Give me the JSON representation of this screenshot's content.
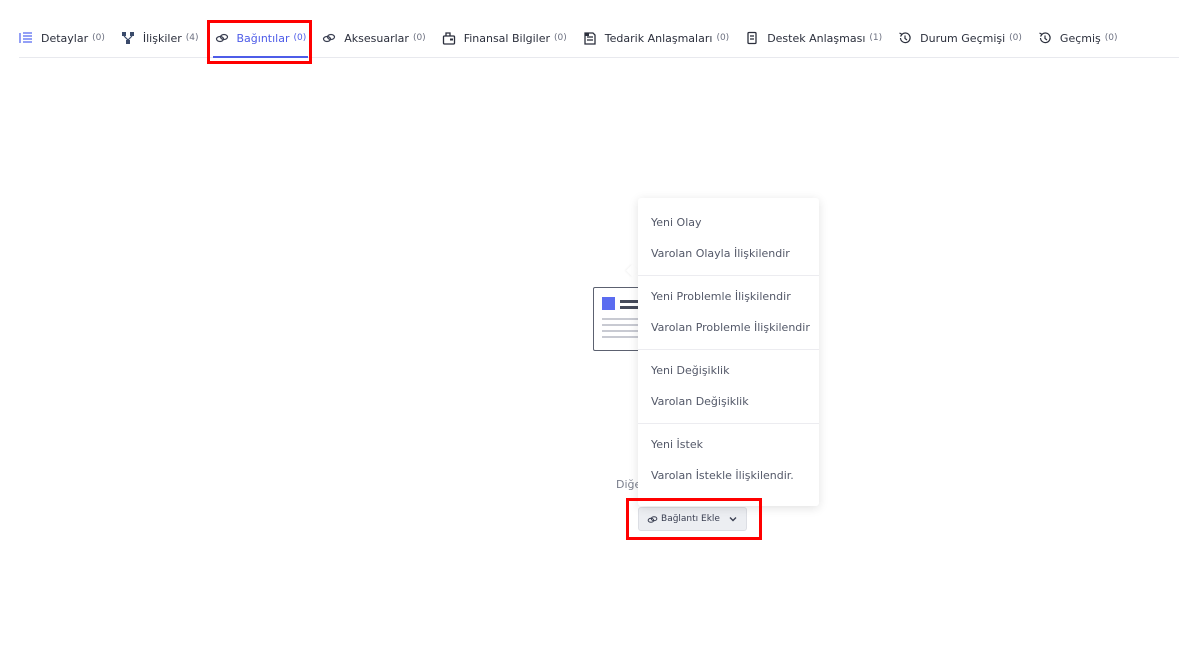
{
  "tabs": [
    {
      "label": "Detaylar",
      "count": "(0)",
      "icon": "list-icon"
    },
    {
      "label": "İlişkiler",
      "count": "(4)",
      "icon": "hierarchy-icon"
    },
    {
      "label": "Bağıntılar",
      "count": "(0)",
      "icon": "link-icon",
      "active": true
    },
    {
      "label": "Aksesuarlar",
      "count": "(0)",
      "icon": "link-icon"
    },
    {
      "label": "Finansal Bilgiler",
      "count": "(0)",
      "icon": "wallet-icon"
    },
    {
      "label": "Tedarik Anlaşmaları",
      "count": "(0)",
      "icon": "document-icon"
    },
    {
      "label": "Destek Anlaşması",
      "count": "(1)",
      "icon": "file-icon"
    },
    {
      "label": "Durum Geçmişi",
      "count": "(0)",
      "icon": "history-icon"
    },
    {
      "label": "Geçmiş",
      "count": "(0)",
      "icon": "history-icon"
    }
  ],
  "empty": {
    "text": "Diğe"
  },
  "add_button": {
    "label": "Bağlantı Ekle"
  },
  "menu": {
    "groups": [
      [
        "Yeni Olay",
        "Varolan Olayla İlişkilendir"
      ],
      [
        "Yeni Problemle İlişkilendir",
        "Varolan Problemle İlişkilendir"
      ],
      [
        "Yeni Değişiklik",
        "Varolan Değişiklik"
      ],
      [
        "Yeni İstek",
        "Varolan İstekle İlişkilendir."
      ]
    ]
  },
  "colors": {
    "accent": "#4e5ce8",
    "highlight": "#ff0000"
  }
}
